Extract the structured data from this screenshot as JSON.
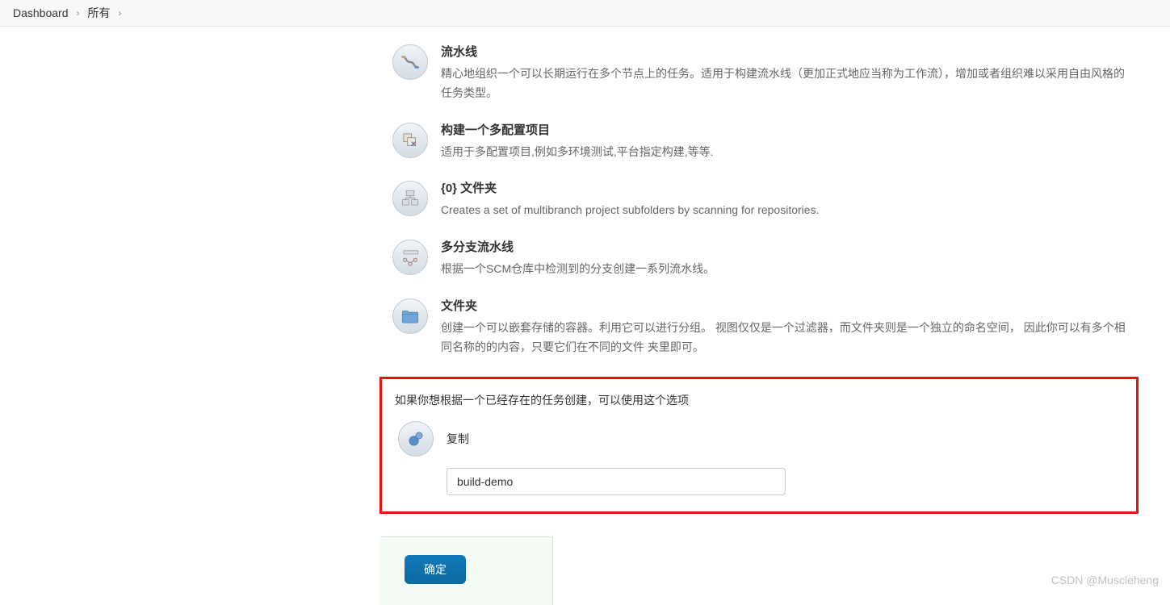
{
  "breadcrumb": {
    "items": [
      "Dashboard",
      "所有"
    ]
  },
  "itemTypes": [
    {
      "id": "pipeline",
      "title": "流水线",
      "desc": "精心地组织一个可以长期运行在多个节点上的任务。适用于构建流水线（更加正式地应当称为工作流），增加或者组织难以采用自由风格的任务类型。"
    },
    {
      "id": "multiconfig",
      "title": "构建一个多配置项目",
      "desc": "适用于多配置项目,例如多环境测试,平台指定构建,等等."
    },
    {
      "id": "folder0",
      "title": "{0} 文件夹",
      "desc": "Creates a set of multibranch project subfolders by scanning for repositories."
    },
    {
      "id": "multibranch",
      "title": "多分支流水线",
      "desc": "根据一个SCM仓库中检测到的分支创建一系列流水线。"
    },
    {
      "id": "folder",
      "title": "文件夹",
      "desc": "创建一个可以嵌套存储的容器。利用它可以进行分组。 视图仅仅是一个过滤器，而文件夹则是一个独立的命名空间， 因此你可以有多个相同名称的的内容，只要它们在不同的文件 夹里即可。"
    }
  ],
  "copySection": {
    "heading": "如果你想根据一个已经存在的任务创建，可以使用这个选项",
    "label": "复制",
    "inputValue": "build-demo"
  },
  "footer": {
    "submitLabel": "确定"
  },
  "watermark": "CSDN @Muscleheng"
}
